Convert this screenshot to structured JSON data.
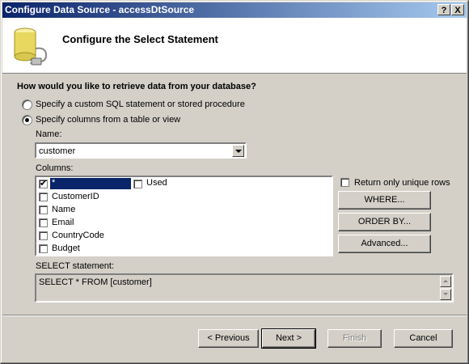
{
  "window": {
    "title": "Configure Data Source - accessDtSource",
    "help_label": "?",
    "close_label": "X"
  },
  "header": {
    "title": "Configure the Select Statement",
    "icon": "database-icon"
  },
  "question": "How would you like to retrieve data from your database?",
  "options": {
    "custom_sql": {
      "label": "Specify a custom SQL statement or stored procedure",
      "selected": false
    },
    "columns": {
      "label": "Specify columns from a table or view",
      "selected": true
    }
  },
  "name": {
    "label": "Name:",
    "value": "customer"
  },
  "columns": {
    "label": "Columns:",
    "items": [
      {
        "label": "*",
        "checked": true,
        "selected": true
      },
      {
        "label": "CustomerID",
        "checked": false
      },
      {
        "label": "Name",
        "checked": false
      },
      {
        "label": "Email",
        "checked": false
      },
      {
        "label": "CountryCode",
        "checked": false
      },
      {
        "label": "Budget",
        "checked": false
      }
    ],
    "second_column": [
      {
        "label": "Used",
        "checked": false
      }
    ]
  },
  "unique_rows": {
    "label": "Return only unique rows",
    "checked": false
  },
  "side_buttons": {
    "where": "WHERE...",
    "order_by": "ORDER BY...",
    "advanced": "Advanced..."
  },
  "select_statement": {
    "label": "SELECT statement:",
    "value": "SELECT * FROM [customer]"
  },
  "footer": {
    "previous": "< Previous",
    "next": "Next >",
    "finish": "Finish",
    "cancel": "Cancel"
  }
}
